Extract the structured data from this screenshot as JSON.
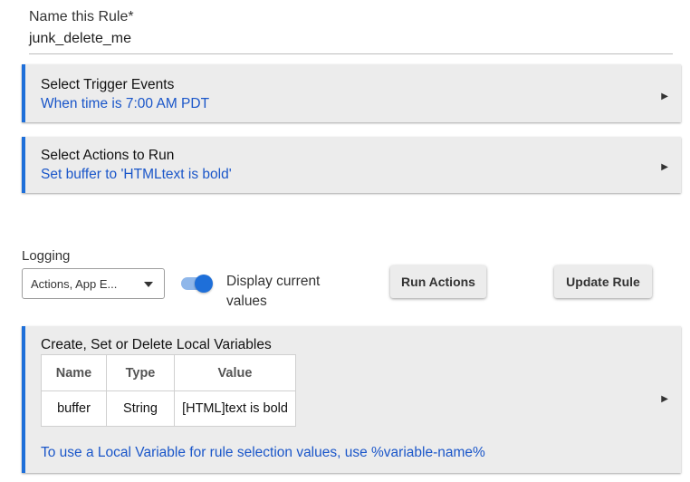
{
  "rule_name": {
    "label": "Name this Rule*",
    "value": "junk_delete_me"
  },
  "triggers": {
    "title": "Select Trigger Events",
    "summary": "When time is 7:00 AM PDT",
    "expand_icon": "triangle-right"
  },
  "actions": {
    "title": "Select Actions to Run",
    "summary": "Set buffer to 'HTMLtext is bold'",
    "expand_icon": "triangle-right"
  },
  "logging": {
    "label": "Logging",
    "selected": "Actions, App E..."
  },
  "display_values_toggle": {
    "label": "Display current values",
    "on": true
  },
  "buttons": {
    "run_actions": "Run Actions",
    "update_rule": "Update Rule"
  },
  "local_vars": {
    "title": "Create, Set or Delete Local Variables",
    "columns": [
      "Name",
      "Type",
      "Value"
    ],
    "rows": [
      [
        "buffer",
        "String",
        "[HTML]text is bold"
      ]
    ],
    "note": "To use a Local Variable for rule selection values, use %variable-name%"
  },
  "colors": {
    "accent": "#1e6fd9",
    "link": "#1a56c9",
    "panel_bg": "#ececec"
  }
}
